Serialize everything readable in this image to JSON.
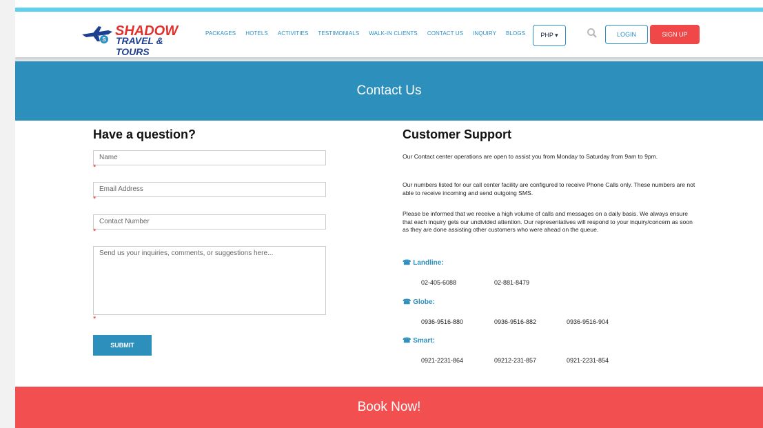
{
  "brand": {
    "line1": "SHADOW",
    "line2": "TRAVEL & TOURS"
  },
  "nav": {
    "items": [
      "PACKAGES",
      "HOTELS",
      "ACTIVITIES",
      "TESTIMONIALS",
      "WALK-IN CLIENTS",
      "CONTACT US",
      "INQUIRY",
      "BLOGS"
    ]
  },
  "currency": {
    "label": "PHP ▾"
  },
  "auth": {
    "login": "LOGIN",
    "signup": "SIGN UP"
  },
  "hero": {
    "title": "Contact Us"
  },
  "form": {
    "heading": "Have a question?",
    "name_placeholder": "Name",
    "email_placeholder": "Email Address",
    "contact_placeholder": "Contact Number",
    "message_placeholder": "Send us your inquiries, comments, or suggestions here...",
    "required_mark": "*",
    "submit": "SUBMIT"
  },
  "support": {
    "heading": "Customer Support",
    "p1": "Our Contact center operations are open to assist you from Monday to Saturday from 9am to 9pm.",
    "p2": "Our numbers listed for our call center facility are configured to receive Phone Calls only. These numbers are not able to receive incoming and send outgoing SMS.",
    "p3": "Please be informed that we receive a high volume of calls and messages on a daily basis. We always ensure that each inquiry gets our undivided attention. Our representatives will respond to your inquiry/concern as soon as they are done assisting other customers who were ahead on the queue.",
    "landline": {
      "label": "☎ Landline:",
      "numbers": [
        "02-405-6088",
        "02-881-8479"
      ]
    },
    "globe": {
      "label": "☎ Globe:",
      "numbers": [
        "0936-9516-880",
        "0936-9516-882",
        "0936-9516-904"
      ]
    },
    "smart": {
      "label": "☎ Smart:",
      "numbers": [
        "0921-2231-864",
        "09212-231-857",
        "0921-2231-854"
      ]
    }
  },
  "footer": {
    "cta": "Book Now!"
  }
}
